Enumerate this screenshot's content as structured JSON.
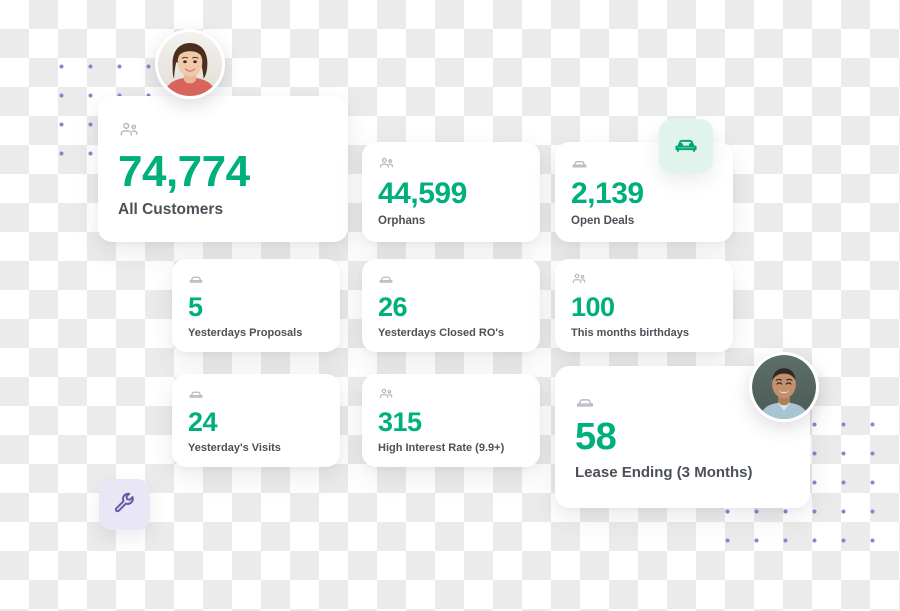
{
  "theme": {
    "accent_green": "#00b07c",
    "badge_green_bg": "#e0f4ec",
    "badge_purple_bg": "#e9e6f6",
    "dot_purple": "#8b84c9",
    "label_gray": "#4b5157",
    "icon_gray": "#b6bcc4",
    "card_bg": "#ffffff"
  },
  "stats": [
    {
      "id": "all-customers",
      "value": "74,774",
      "label": "All Customers",
      "icon": "people-icon"
    },
    {
      "id": "orphans",
      "value": "44,599",
      "label": "Orphans",
      "icon": "people-icon"
    },
    {
      "id": "open-deals",
      "value": "2,139",
      "label": "Open Deals",
      "icon": "car-icon"
    },
    {
      "id": "yesterdays-proposals",
      "value": "5",
      "label": "Yesterdays Proposals",
      "icon": "car-icon"
    },
    {
      "id": "yesterdays-closed-ros",
      "value": "26",
      "label": "Yesterdays Closed RO's",
      "icon": "car-icon"
    },
    {
      "id": "this-months-birthdays",
      "value": "100",
      "label": "This months birthdays",
      "icon": "people-icon"
    },
    {
      "id": "yesterdays-visits",
      "value": "24",
      "label": "Yesterday's Visits",
      "icon": "car-icon"
    },
    {
      "id": "high-interest-rate",
      "value": "315",
      "label": "High Interest Rate (9.9+)",
      "icon": "people-icon"
    },
    {
      "id": "lease-ending",
      "value": "58",
      "label": "Lease Ending (3 Months)",
      "icon": "car-icon"
    }
  ],
  "badges": [
    {
      "id": "car-badge",
      "icon": "car-icon"
    },
    {
      "id": "tool-badge",
      "icon": "wrench-icon"
    }
  ],
  "avatars": [
    {
      "id": "avatar-top",
      "icon": "user-photo-woman"
    },
    {
      "id": "avatar-bottom",
      "icon": "user-photo-man"
    }
  ]
}
